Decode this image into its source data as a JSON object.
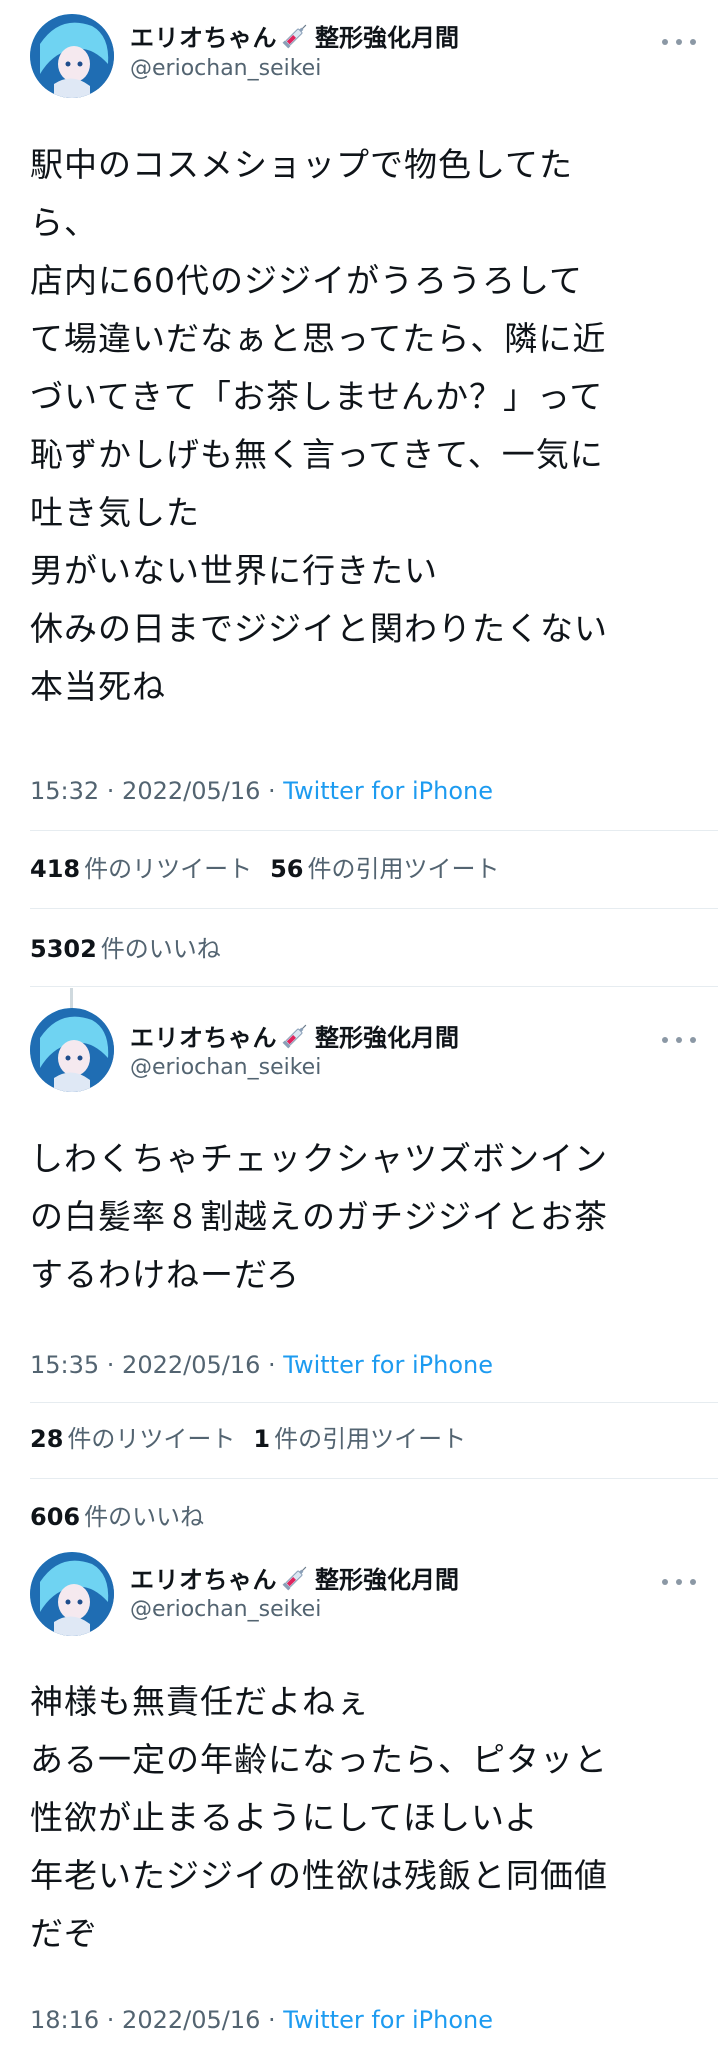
{
  "tweets": [
    {
      "display_name": "エリオちゃん",
      "badge": "整形強化月間",
      "handle": "@eriochan_seikei",
      "lines": [
        "駅中のコスメショップで物色してた",
        "ら、",
        "店内に60代のジジイがうろうろして",
        "て場違いだなぁと思ってたら、隣に近",
        "づいてきて「お茶しませんか？」って",
        "恥ずかしげも無く言ってきて、一気に",
        "吐き気した",
        "男がいない世界に行きたい",
        "休みの日までジジイと関わりたくない",
        "本当死ね"
      ],
      "time": "15:32 · 2022/05/16 · ",
      "client": "Twitter for iPhone",
      "retweets": "418",
      "retweets_label": "件のリツイート",
      "quotes": "56",
      "quotes_label": "件の引用ツイート",
      "likes": "5302",
      "likes_label": "件のいいね"
    },
    {
      "display_name": "エリオちゃん",
      "badge": "整形強化月間",
      "handle": "@eriochan_seikei",
      "lines": [
        "しわくちゃチェックシャツズボンイン",
        "の白髪率８割越えのガチジジイとお茶",
        "するわけねーだろ"
      ],
      "time": "15:35 · 2022/05/16 · ",
      "client": "Twitter for iPhone",
      "retweets": "28",
      "retweets_label": "件のリツイート",
      "quotes": "1",
      "quotes_label": "件の引用ツイート",
      "likes": "606",
      "likes_label": "件のいいね"
    },
    {
      "display_name": "エリオちゃん",
      "badge": "整形強化月間",
      "handle": "@eriochan_seikei",
      "lines": [
        "神様も無責任だよねぇ",
        "ある一定の年齢になったら、ピタッと",
        "性欲が止まるようにしてほしいよ",
        "年老いたジジイの性欲は残飯と同価値",
        "だぞ"
      ],
      "time": "18:16 · 2022/05/16 · ",
      "client": "Twitter for iPhone"
    }
  ],
  "icons": {
    "avatar": "avatar-image",
    "syringe": "syringe-icon",
    "more": "more-options-icon"
  },
  "colors": {
    "link": "#1d9bf0",
    "secondary_text": "#536471",
    "divider": "#e6ecf0"
  }
}
